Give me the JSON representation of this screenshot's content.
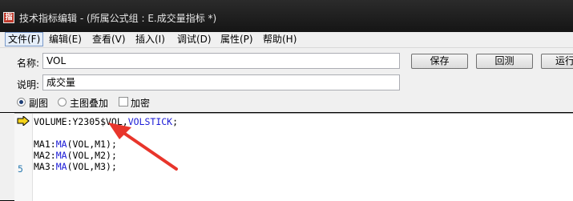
{
  "window": {
    "title": "技术指标编辑 - (所属公式组 : E.成交量指标 *)"
  },
  "menu": [
    {
      "label": "文件(F)"
    },
    {
      "label": "编辑(E)"
    },
    {
      "label": "查看(V)"
    },
    {
      "label": "插入(I)"
    },
    {
      "label": "调试(D)"
    },
    {
      "label": "属性(P)"
    },
    {
      "label": "帮助(H)"
    }
  ],
  "form": {
    "name_label": "名称:",
    "name_value": "VOL",
    "desc_label": "说明:",
    "desc_value": "成交量",
    "buttons": {
      "save": "保存",
      "reset": "回测",
      "run": "运行"
    },
    "options": {
      "sub_chart": "副图",
      "main_overlay": "主图叠加",
      "encrypt": "加密"
    },
    "selected_option": "副图",
    "encrypt_checked": false
  },
  "editor": {
    "lines": [
      {
        "parts": [
          {
            "t": "VOLUME:Y2305$VOL,",
            "kw": false
          },
          {
            "t": "VOLSTICK",
            "kw": true
          },
          {
            "t": ";",
            "kw": false
          }
        ]
      },
      {
        "parts": []
      },
      {
        "parts": [
          {
            "t": "MA1:",
            "kw": false
          },
          {
            "t": "MA",
            "kw": true
          },
          {
            "t": "(VOL,M1);",
            "kw": false
          }
        ]
      },
      {
        "parts": [
          {
            "t": "MA2:",
            "kw": false
          },
          {
            "t": "MA",
            "kw": true
          },
          {
            "t": "(VOL,M2);",
            "kw": false
          }
        ]
      },
      {
        "parts": [
          {
            "t": "MA3:",
            "kw": false
          },
          {
            "t": "MA",
            "kw": true
          },
          {
            "t": "(VOL,M3);",
            "kw": false
          }
        ]
      }
    ],
    "line_number_shown": "5",
    "annotation_color": "#e8352b",
    "marker_color": "#f3d21b"
  }
}
